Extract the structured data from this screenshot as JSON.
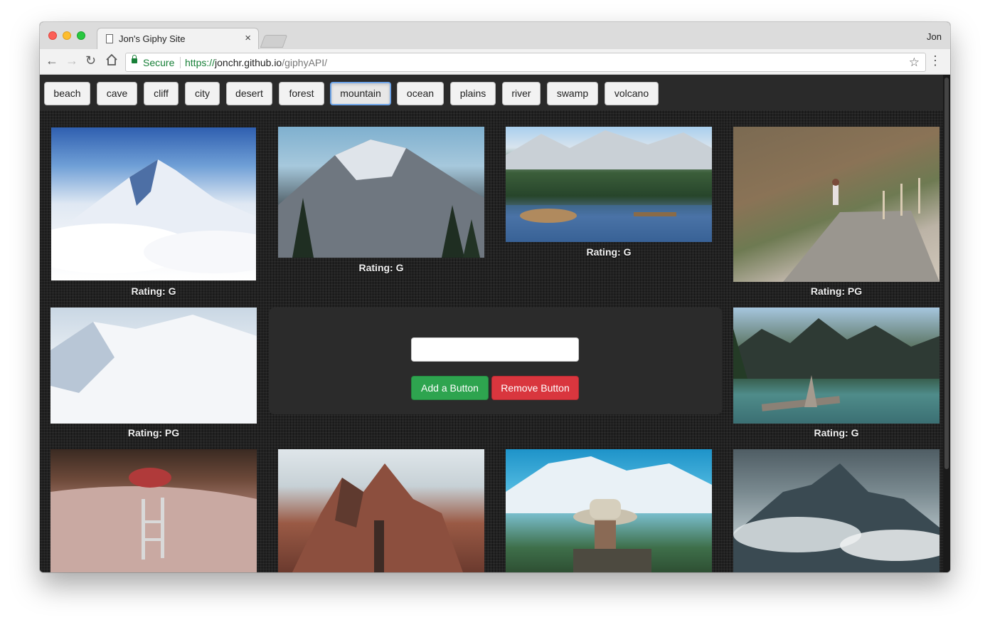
{
  "browser": {
    "tab_title": "Jon's Giphy Site",
    "tab_close": "×",
    "profile_name": "Jon",
    "secure_label": "Secure",
    "url_scheme": "https://",
    "url_host": "jonchr.github.io",
    "url_path": "/giphyAPI/"
  },
  "topics": {
    "buttons": [
      "beach",
      "cave",
      "cliff",
      "city",
      "desert",
      "forest",
      "mountain",
      "ocean",
      "plains",
      "river",
      "swamp",
      "volcano"
    ],
    "active": "mountain"
  },
  "gifs": [
    {
      "rating": "Rating: G",
      "subject": "snowy peak above clouds"
    },
    {
      "rating": "Rating: G",
      "subject": "volcanic mountain with pine trees"
    },
    {
      "rating": "Rating: G",
      "subject": "alpine lake and forest"
    },
    {
      "rating": "Rating: PG",
      "subject": "person on path by hillside"
    },
    {
      "rating": "Rating: PG",
      "subject": "snowy slope"
    },
    {
      "rating": "Rating: G",
      "subject": "mountain lake with driftwood"
    },
    {
      "rating": "",
      "subject": "skateboarder in pool"
    },
    {
      "rating": "",
      "subject": "rocky theme park mountain"
    },
    {
      "rating": "",
      "subject": "man in hat before snowy mountain"
    },
    {
      "rating": "",
      "subject": "misty mountain peak"
    }
  ],
  "form": {
    "input_value": "",
    "add_label": "Add a Button",
    "remove_label": "Remove Button"
  },
  "colors": {
    "add_button": "#2ea44f",
    "remove_button": "#d9363e",
    "active_outline": "#6fa5e8"
  }
}
